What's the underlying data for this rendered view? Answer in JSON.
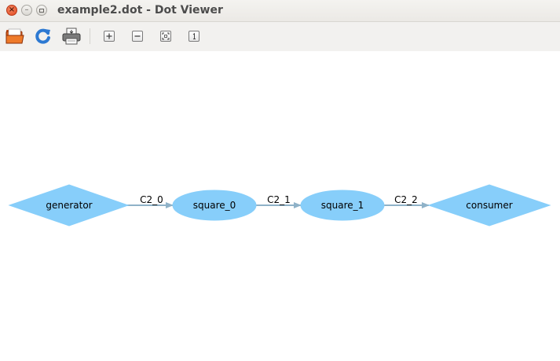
{
  "window": {
    "title": "example2.dot - Dot Viewer"
  },
  "titlebar_buttons": [
    {
      "name": "close",
      "icon": "close-icon"
    },
    {
      "name": "minimize",
      "icon": "minimize-icon"
    },
    {
      "name": "maximize",
      "icon": "maximize-icon"
    }
  ],
  "toolbar": {
    "buttons": [
      {
        "name": "open",
        "icon": "folder-open-icon"
      },
      {
        "name": "reload",
        "icon": "refresh-icon"
      },
      {
        "name": "print",
        "icon": "printer-icon"
      },
      {
        "name": "zoom-in",
        "icon": "zoom-in-icon"
      },
      {
        "name": "zoom-out",
        "icon": "zoom-out-icon"
      },
      {
        "name": "zoom-fit",
        "icon": "zoom-fit-icon"
      },
      {
        "name": "zoom-100",
        "icon": "zoom-100-icon"
      }
    ]
  },
  "graph": {
    "node_color": "#87cefa",
    "edge_color": "#8fb2c8",
    "nodes": [
      {
        "id": "generator",
        "label": "generator",
        "shape": "diamond"
      },
      {
        "id": "square_0",
        "label": "square_0",
        "shape": "ellipse"
      },
      {
        "id": "square_1",
        "label": "square_1",
        "shape": "ellipse"
      },
      {
        "id": "consumer",
        "label": "consumer",
        "shape": "diamond"
      }
    ],
    "edges": [
      {
        "from": "generator",
        "to": "square_0",
        "label": "C2_0"
      },
      {
        "from": "square_0",
        "to": "square_1",
        "label": "C2_1"
      },
      {
        "from": "square_1",
        "to": "consumer",
        "label": "C2_2"
      }
    ]
  }
}
